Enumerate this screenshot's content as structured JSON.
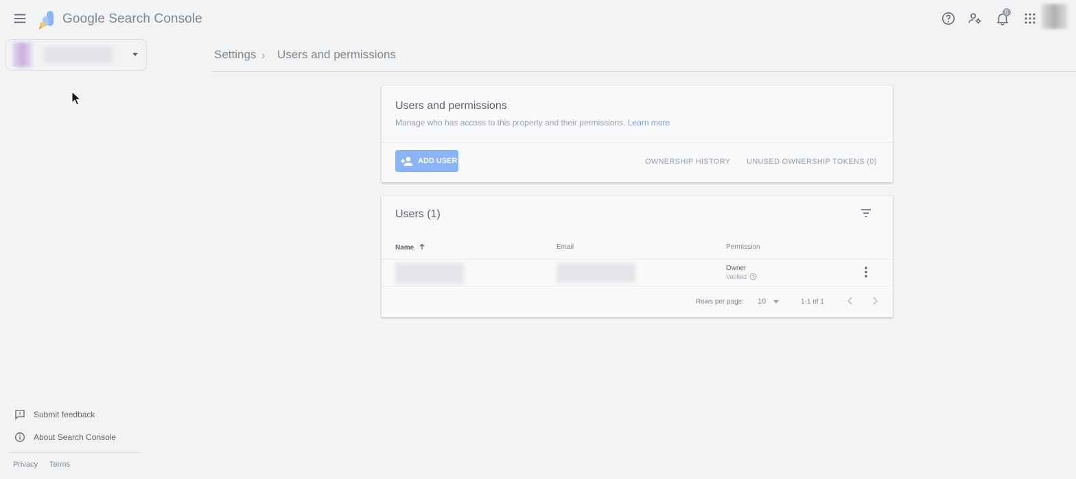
{
  "app": {
    "title": "Google Search Console"
  },
  "header": {
    "notifications_count": "5"
  },
  "breadcrumb": {
    "parent": "Settings",
    "separator": "›",
    "current": "Users and permissions"
  },
  "permissions_card": {
    "title": "Users and permissions",
    "description": "Manage who has access to this property and their permissions.",
    "learn_more": "Learn more",
    "add_user": "ADD USER",
    "ownership_history": "OWNERSHIP HISTORY",
    "unused_tokens": "UNUSED OWNERSHIP TOKENS (0)"
  },
  "users_card": {
    "title": "Users (1)",
    "columns": {
      "name": "Name",
      "email": "Email",
      "permission": "Permission"
    },
    "rows": [
      {
        "permission": "Owner",
        "status": "Verified"
      }
    ],
    "rows_per_page_label": "Rows per page:",
    "rows_per_page_value": "10",
    "range": "1-1 of 1"
  },
  "sidebar": {
    "submit_feedback": "Submit feedback",
    "about": "About Search Console",
    "privacy": "Privacy",
    "terms": "Terms"
  },
  "colors": {
    "accent": "#8ab4f8",
    "link": "#7b9ce0",
    "background": "#f1f3f4",
    "card": "#f8f9fa"
  }
}
